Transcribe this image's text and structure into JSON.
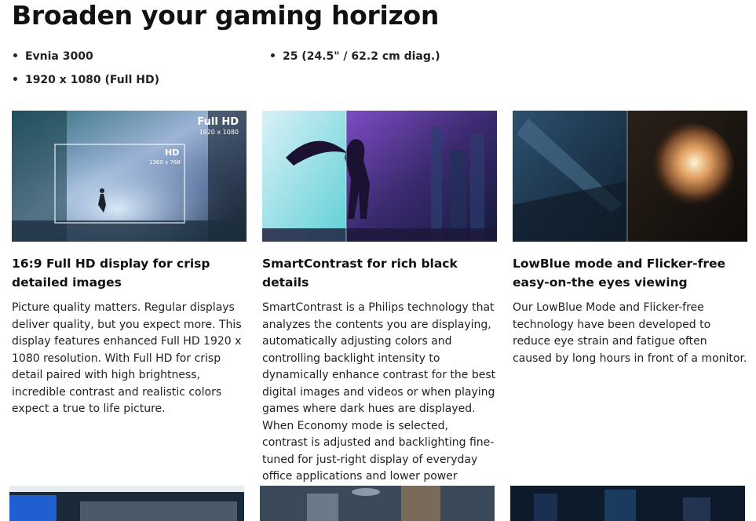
{
  "page": {
    "title": "Broaden your gaming horizon"
  },
  "specs": [
    "Evnia 3000",
    "25 (24.5\" / 62.2 cm diag.)",
    "1920 x 1080 (Full HD)"
  ],
  "cards": [
    {
      "title": "16:9 Full HD display for crisp detailed images",
      "body": "Picture quality matters. Regular displays deliver quality, but you expect more. This display features enhanced Full HD 1920 x 1080 resolution. With Full HD for crisp detail paired with high brightness, incredible contrast and realistic colors expect a true to life picture.",
      "image_labels": {
        "fullhd": "Full HD",
        "fullhd_res": "1920 x 1080",
        "hd": "HD",
        "hd_res": "1360 x 768"
      }
    },
    {
      "title": "SmartContrast for rich black details",
      "body": "SmartContrast is a Philips technology that analyzes the contents you are displaying, automatically adjusting colors and controlling backlight intensity to dynamically enhance contrast for the best digital images and videos or when playing games where dark hues are displayed. When Economy mode is selected, contrast is adjusted and backlighting fine-tuned for just-right display of everyday office applications and lower power consumption."
    },
    {
      "title": "LowBlue mode and Flicker-free easy-on-the eyes viewing",
      "body": "Our LowBlue Mode and Flicker-free technology have been developed to reduce eye strain and fatigue often caused by long hours in front of a monitor."
    }
  ]
}
